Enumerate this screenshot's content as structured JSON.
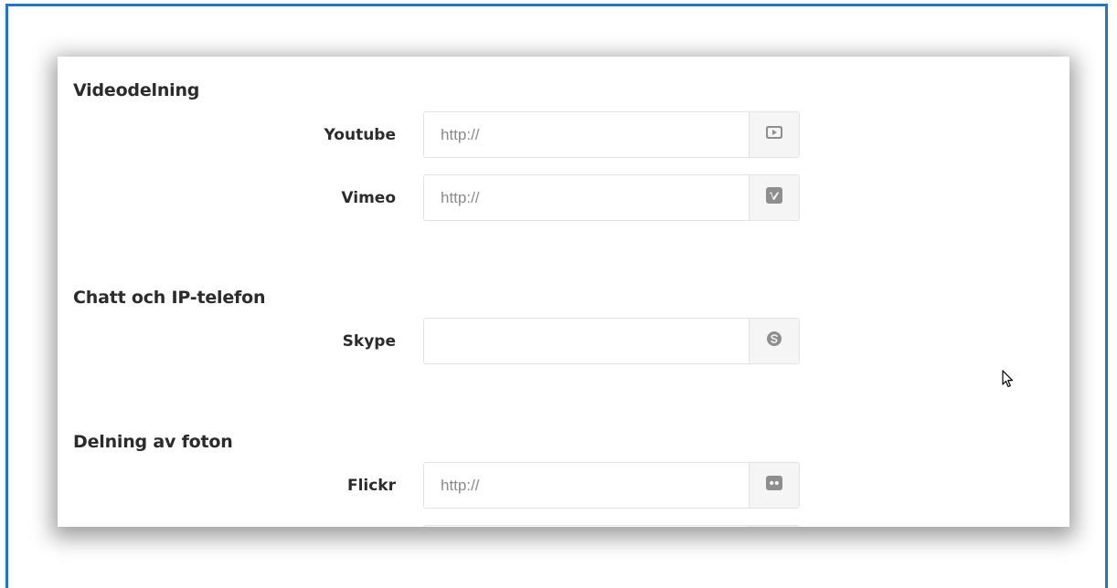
{
  "sections": [
    {
      "title": "Videodelning",
      "fields": [
        {
          "label": "Youtube",
          "value": "",
          "placeholder": "http://",
          "icon": "youtube-icon"
        },
        {
          "label": "Vimeo",
          "value": "",
          "placeholder": "http://",
          "icon": "vimeo-icon"
        }
      ]
    },
    {
      "title": "Chatt och IP-telefon",
      "fields": [
        {
          "label": "Skype",
          "value": "",
          "placeholder": "",
          "icon": "skype-icon"
        }
      ]
    },
    {
      "title": "Delning av foton",
      "fields": [
        {
          "label": "Flickr",
          "value": "",
          "placeholder": "http://",
          "icon": "flickr-icon"
        }
      ]
    }
  ],
  "colors": {
    "frame_border": "#1f77c6",
    "icon": "#8e8e8e",
    "addon_bg": "#f5f5f5"
  }
}
